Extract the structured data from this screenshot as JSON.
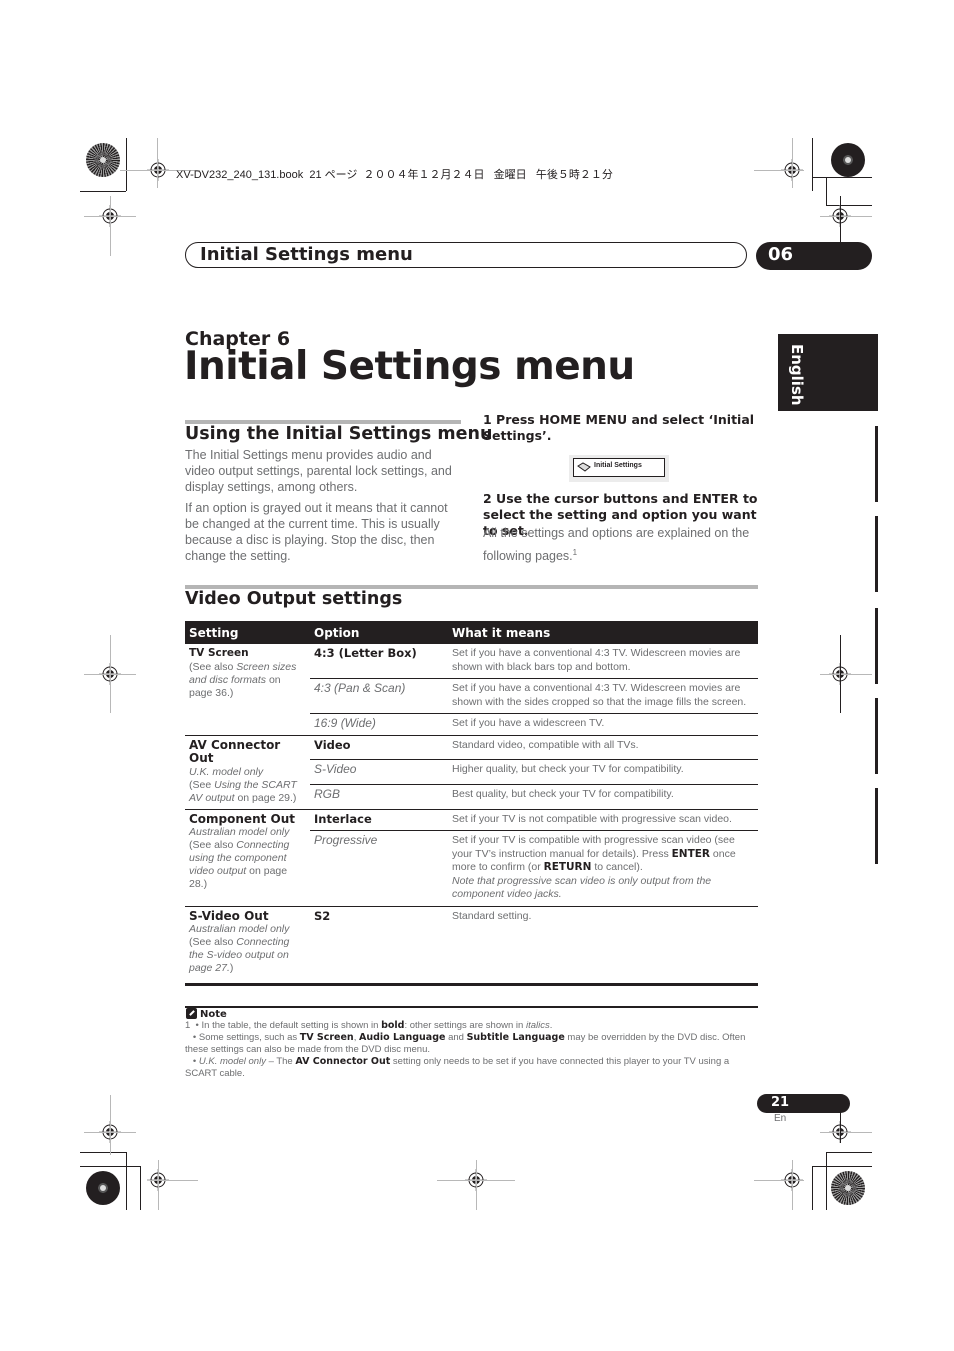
{
  "print_header": {
    "file_line": "XV-DV232_240_131.book  21 ページ  ２００４年１２月２４日   金曜日   午後５時２１分"
  },
  "running_header": {
    "title": "Initial Settings menu",
    "chapter_number": "06"
  },
  "chapter": {
    "label": "Chapter 6",
    "title": "Initial Settings menu"
  },
  "language_tab": "English",
  "section_using": {
    "heading": "Using the Initial Settings menu",
    "paragraphs": [
      "The Initial Settings menu provides audio and video output settings, parental lock settings, and display settings, among others.",
      "If an option is grayed out it means that it cannot be changed at the current time. This is usually because a disc is playing. Stop the disc, then change the setting."
    ]
  },
  "steps": {
    "step1": "1    Press HOME MENU and select ‘Initial Settings’.",
    "osd_label": "Initial Settings",
    "osd_icon": "settings-wrench-icon",
    "step2": "2    Use the cursor buttons and ENTER to select the setting and option you want to set.",
    "step2_body": "All the settings and options are explained on the following pages.",
    "step2_footnote_ref": "1"
  },
  "section_video": {
    "heading": "Video Output settings",
    "table": {
      "headers": [
        "Setting",
        "Option",
        "What it means"
      ],
      "groups": [
        {
          "setting": "TV Screen",
          "note_prefix": "(See also ",
          "note_italic": "Screen sizes and disc formats",
          "note_suffix": " on page 36.)",
          "rows": [
            {
              "option": "4:3 (Letter Box)",
              "default": true,
              "desc": "Set if you have a conventional 4:3 TV. Widescreen movies are shown with black bars top and bottom."
            },
            {
              "option": "4:3 (Pan & Scan)",
              "default": false,
              "desc": "Set if you have a conventional 4:3 TV. Widescreen movies are shown with the sides cropped so that the image fills the screen."
            },
            {
              "option": "16:9 (Wide)",
              "default": false,
              "desc": "Set if you have a widescreen TV."
            }
          ]
        },
        {
          "setting": "AV Connector Out",
          "model_note": "U.K. model only",
          "note_prefix": "(See ",
          "note_italic": "Using the SCART AV output",
          "note_suffix": " on page 29.)",
          "rows": [
            {
              "option": "Video",
              "default": true,
              "desc": "Standard video, compatible with all TVs."
            },
            {
              "option": "S-Video",
              "default": false,
              "desc": "Higher quality, but check your TV for compatibility."
            },
            {
              "option": "RGB",
              "default": false,
              "desc": "Best quality, but check your TV for compatibility."
            }
          ]
        },
        {
          "setting": "Component Out",
          "model_note": "Australian model only",
          "note_prefix": "(See also ",
          "note_italic": "Connecting using the component video output",
          "note_suffix": " on page 28.)",
          "rows": [
            {
              "option": "Interlace",
              "default": true,
              "desc": "Set if your TV is not compatible with progressive scan video."
            },
            {
              "option": "Progressive",
              "default": false,
              "desc_a": "Set if your TV is compatible with progressive scan video (see your TV’s instruction manual for details). Press ",
              "desc_b1": "ENTER",
              "desc_c": " once more to confirm (or ",
              "desc_b2": "RETURN",
              "desc_d": " to cancel).",
              "desc_note": "Note that progressive scan video is only output from the component video jacks."
            }
          ]
        },
        {
          "setting": "S-Video Out",
          "model_note": "Australian model only",
          "note_prefix": "(See also ",
          "note_italic": "Connecting the S-video output on page 27.",
          "note_suffix": ")",
          "rows": [
            {
              "option": "S2",
              "default": true,
              "desc": "Standard setting."
            }
          ]
        }
      ]
    }
  },
  "notes": {
    "heading": "Note",
    "icon": "note-pencil-icon",
    "n1_a": "1  • In the table, the default setting is shown in ",
    "n1_bold": "bold",
    "n1_b": ": other settings are shown in ",
    "n1_italic": "italics",
    "n1_c": ".",
    "n2_a": "   • Some settings, such as ",
    "n2_b1": "TV Screen",
    "n2_sep1": ", ",
    "n2_b2": "Audio Language",
    "n2_sep2": " and ",
    "n2_b3": "Subtitle Language",
    "n2_c": " may be overridden by the DVD disc. Often these settings can also be made from the DVD disc menu.",
    "n3_a": "   • ",
    "n3_italic": "U.K. model only",
    "n3_b": " – The ",
    "n3_bold": "AV Connector Out",
    "n3_c": " setting only needs to be set if you have connected this player to your TV using a SCART cable."
  },
  "page": {
    "number": "21",
    "lang": "En"
  }
}
